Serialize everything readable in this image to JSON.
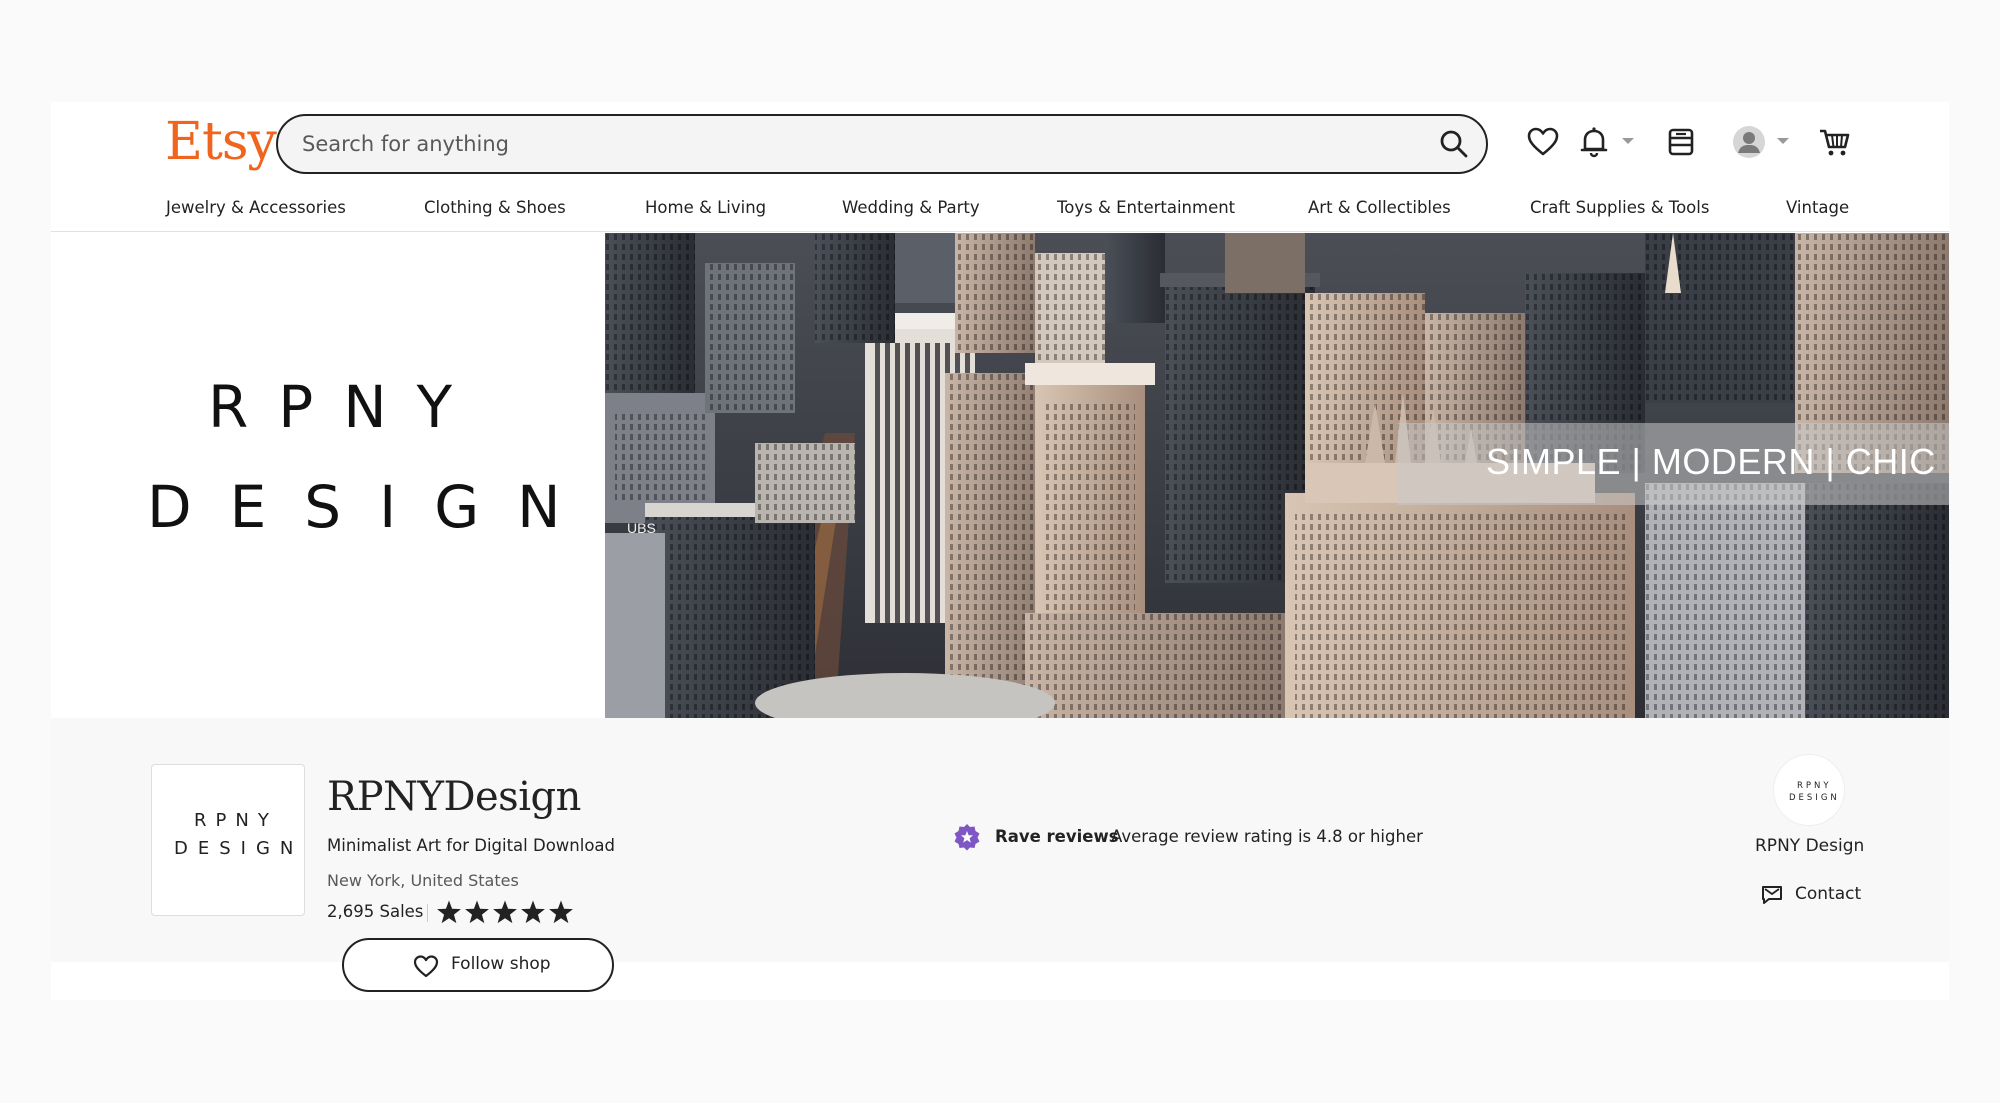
{
  "header": {
    "logo": "Etsy",
    "search_placeholder": "Search for anything"
  },
  "nav": {
    "items": [
      "Jewelry & Accessories",
      "Clothing & Shoes",
      "Home & Living",
      "Wedding & Party",
      "Toys & Entertainment",
      "Art & Collectibles",
      "Craft Supplies & Tools",
      "Vintage"
    ]
  },
  "banner": {
    "logo_line1": "RPNY",
    "logo_line2": "DESIGN",
    "tagline": "SIMPLE | MODERN | CHIC",
    "sign_text": "UBS"
  },
  "shop": {
    "avatar_line1": "RPNY",
    "avatar_line2": "DESIGN",
    "name": "RPNYDesign",
    "tagline": "Minimalist Art for Digital Download",
    "location": "New York, United States",
    "sales": "2,695 Sales",
    "rating_stars": 5,
    "follow_label": "Follow shop"
  },
  "rave": {
    "title": "Rave reviews",
    "description": "Average review rating is 4.8 or higher"
  },
  "owner": {
    "avatar_line1": "RPNY",
    "avatar_line2": "DESIGN",
    "name": "RPNY Design",
    "contact_label": "Contact"
  },
  "colors": {
    "brand": "#f1641e",
    "rave_badge": "#7f57c5",
    "text": "#222222"
  },
  "icons": [
    "search-icon",
    "heart-icon",
    "bell-icon",
    "shop-icon",
    "avatar-icon",
    "cart-icon",
    "star-icon",
    "rave-badge-icon",
    "mail-icon"
  ]
}
